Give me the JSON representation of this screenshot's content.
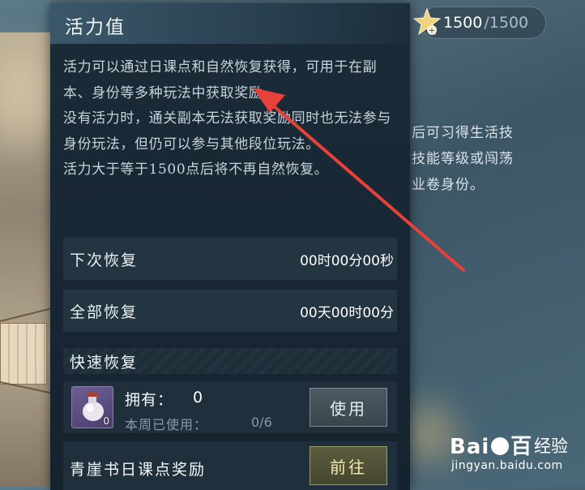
{
  "resource": {
    "current": "1500",
    "max": "/1500",
    "icon": "stamina-star-icon"
  },
  "background": {
    "text_lines": [
      "后可习得生活技",
      "技能等级或闯荡",
      "业卷身份。"
    ]
  },
  "panel": {
    "title": "活力值",
    "description": [
      "活力可以通过日课点和自然恢复获得，可用于在副本、身份等多种玩法中获取奖励。",
      "没有活力时，通关副本无法获取奖励同时也无法参与身份玩法，但仍可以参与其他段位玩法。",
      "活力大于等于1500点后将不再自然恢复。"
    ],
    "next_recovery": {
      "label": "下次恢复",
      "value": "00时00分00秒"
    },
    "full_recovery": {
      "label": "全部恢复",
      "value": "00天00时00分"
    },
    "quick_recovery": {
      "header": "快速恢复",
      "item": {
        "icon": "potion-bottle-icon",
        "count": "0",
        "owned_label": "拥有：",
        "owned_value": "0",
        "weekly_label": "本周已使用：",
        "weekly_value": "0/6",
        "use_button": "使用"
      }
    },
    "reward": {
      "label": "青崖书日课点奖励",
      "go_button": "前往"
    }
  },
  "watermark": {
    "brand": "Bai",
    "brand_tail": "百",
    "cn": "经验",
    "url": "jingyan.baidu.com"
  },
  "colors": {
    "accent_arrow": "#e8413a",
    "panel_bg": "#17263a"
  }
}
